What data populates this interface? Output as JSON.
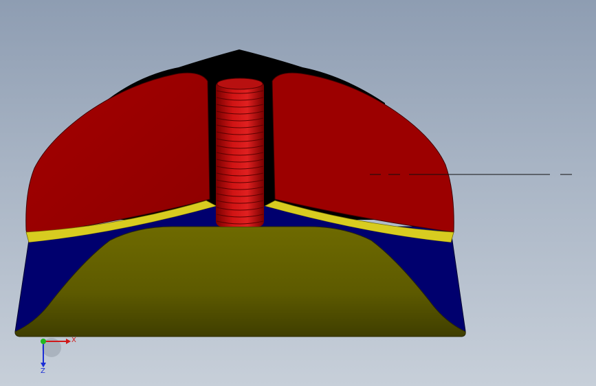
{
  "triad": {
    "x_label": "X",
    "z_label": "Z",
    "colors": {
      "x_axis": "#d01818",
      "z_axis": "#1c2fd6",
      "origin": "#22b81e"
    }
  },
  "model": {
    "colors": {
      "cover": "#9c0000",
      "coil": "#c01010",
      "inner_shell": "#000000",
      "outer_shell": "#00006e",
      "seal_ring": "#d8cc20",
      "base": "#5d5a00"
    }
  }
}
